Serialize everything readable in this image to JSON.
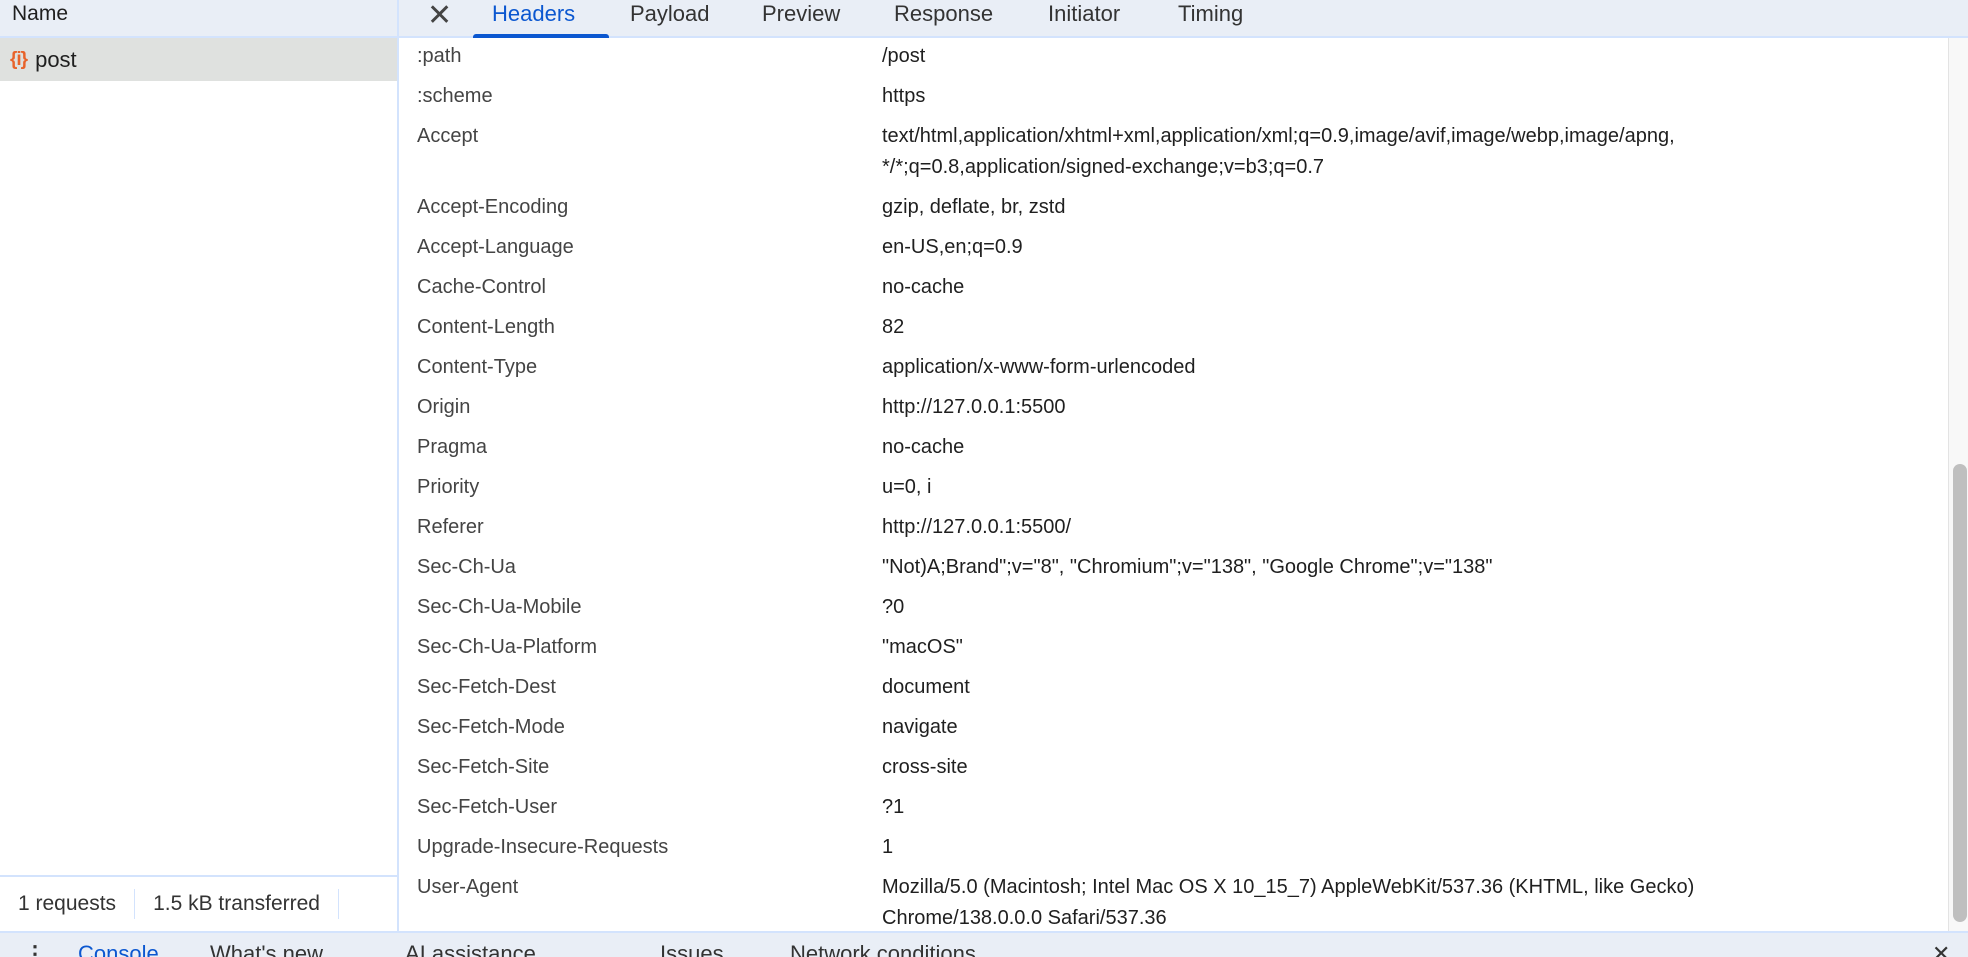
{
  "request_list": {
    "column_header": "Name",
    "items": [
      {
        "icon": "fetch-json-icon",
        "icon_glyph": "{i}",
        "name": "post"
      }
    ],
    "status": {
      "requests": "1 requests",
      "transferred": "1.5 kB transferred"
    }
  },
  "detail_tabs": {
    "close_glyph": "✕",
    "tabs": [
      "Headers",
      "Payload",
      "Preview",
      "Response",
      "Initiator",
      "Timing"
    ],
    "selected": "Headers"
  },
  "headers": [
    {
      "name": ":path",
      "value": [
        "/post"
      ]
    },
    {
      "name": ":scheme",
      "value": [
        "https"
      ]
    },
    {
      "name": "Accept",
      "value": [
        "text/html,application/xhtml+xml,application/xml;q=0.9,image/avif,image/webp,image/apng,",
        "*/*;q=0.8,application/signed-exchange;v=b3;q=0.7"
      ]
    },
    {
      "name": "Accept-Encoding",
      "value": [
        "gzip, deflate, br, zstd"
      ]
    },
    {
      "name": "Accept-Language",
      "value": [
        "en-US,en;q=0.9"
      ]
    },
    {
      "name": "Cache-Control",
      "value": [
        "no-cache"
      ]
    },
    {
      "name": "Content-Length",
      "value": [
        "82"
      ]
    },
    {
      "name": "Content-Type",
      "value": [
        "application/x-www-form-urlencoded"
      ]
    },
    {
      "name": "Origin",
      "value": [
        "http://127.0.0.1:5500"
      ]
    },
    {
      "name": "Pragma",
      "value": [
        "no-cache"
      ]
    },
    {
      "name": "Priority",
      "value": [
        "u=0, i"
      ]
    },
    {
      "name": "Referer",
      "value": [
        "http://127.0.0.1:5500/"
      ]
    },
    {
      "name": "Sec-Ch-Ua",
      "value": [
        "\"Not)A;Brand\";v=\"8\", \"Chromium\";v=\"138\", \"Google Chrome\";v=\"138\""
      ]
    },
    {
      "name": "Sec-Ch-Ua-Mobile",
      "value": [
        "?0"
      ]
    },
    {
      "name": "Sec-Ch-Ua-Platform",
      "value": [
        "\"macOS\""
      ]
    },
    {
      "name": "Sec-Fetch-Dest",
      "value": [
        "document"
      ]
    },
    {
      "name": "Sec-Fetch-Mode",
      "value": [
        "navigate"
      ]
    },
    {
      "name": "Sec-Fetch-Site",
      "value": [
        "cross-site"
      ]
    },
    {
      "name": "Sec-Fetch-User",
      "value": [
        "?1"
      ]
    },
    {
      "name": "Upgrade-Insecure-Requests",
      "value": [
        "1"
      ]
    },
    {
      "name": "User-Agent",
      "value": [
        "Mozilla/5.0 (Macintosh; Intel Mac OS X 10_15_7) AppleWebKit/537.36 (KHTML, like Gecko)",
        "Chrome/138.0.0.0 Safari/537.36"
      ]
    }
  ],
  "drawer": {
    "tabs": [
      "Console",
      "What's new",
      "AI assistance",
      "Issues",
      "Network conditions"
    ],
    "selected": "Console"
  },
  "colors": {
    "accent": "#0b57d0",
    "selected_row": "#dfe1df",
    "toolbar": "#e9eef6",
    "fetch_icon": "#e8632b"
  }
}
